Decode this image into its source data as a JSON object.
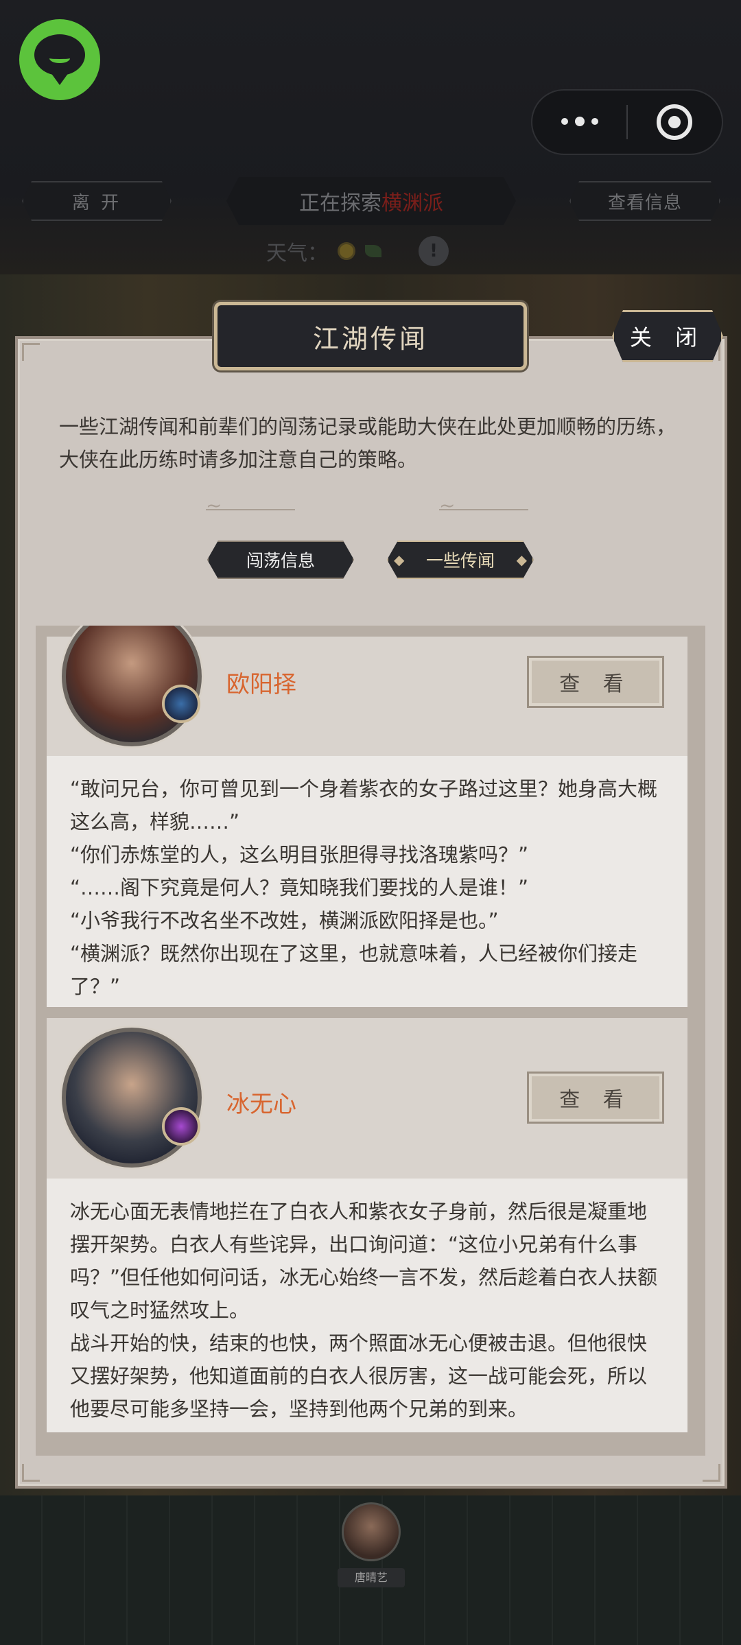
{
  "topbar": {
    "leave_label": "离 开",
    "exploring_prefix": "正在探索",
    "exploring_place": "横渊派",
    "view_info_label": "查看信息",
    "weather_label": "天气：",
    "warn_glyph": "!"
  },
  "modal": {
    "title": "江湖传闻",
    "close_label": "关 闭",
    "intro": "一些江湖传闻和前辈们的闯荡记录或能助大侠在此处更加顺畅的历练，大侠在此历练时请多加注意自己的策略。",
    "tabs": [
      {
        "label": "闯荡信息",
        "active": false
      },
      {
        "label": "一些传闻",
        "active": true
      }
    ]
  },
  "rumors": [
    {
      "name": "欧阳择",
      "view_label": "查 看",
      "text": "“敢问兄台，你可曾见到一个身着紫衣的女子路过这里？她身高大概这么高，样貌……”\n“你们赤炼堂的人，这么明目张胆得寻找洛瑰紫吗？”\n“……阁下究竟是何人？竟知晓我们要找的人是谁！”\n“小爷我行不改名坐不改姓，横渊派欧阳择是也。”\n“横渊派？既然你出现在了这里，也就意味着，人已经被你们接走了？”"
    },
    {
      "name": "冰无心",
      "view_label": "查 看",
      "text": "冰无心面无表情地拦在了白衣人和紫衣女子身前，然后很是凝重地摆开架势。白衣人有些诧异，出口询问道：“这位小兄弟有什么事吗？”但任他如何问话，冰无心始终一言不发，然后趁着白衣人扶额叹气之时猛然攻上。\n战斗开始的快，结束的也快，两个照面冰无心便被击退。但他很快又摆好架势，他知道面前的白衣人很厉害，这一战可能会死，所以他要尽可能多坚持一会，坚持到他两个兄弟的到来。"
    }
  ],
  "scene": {
    "npc_name": "唐晴艺"
  }
}
